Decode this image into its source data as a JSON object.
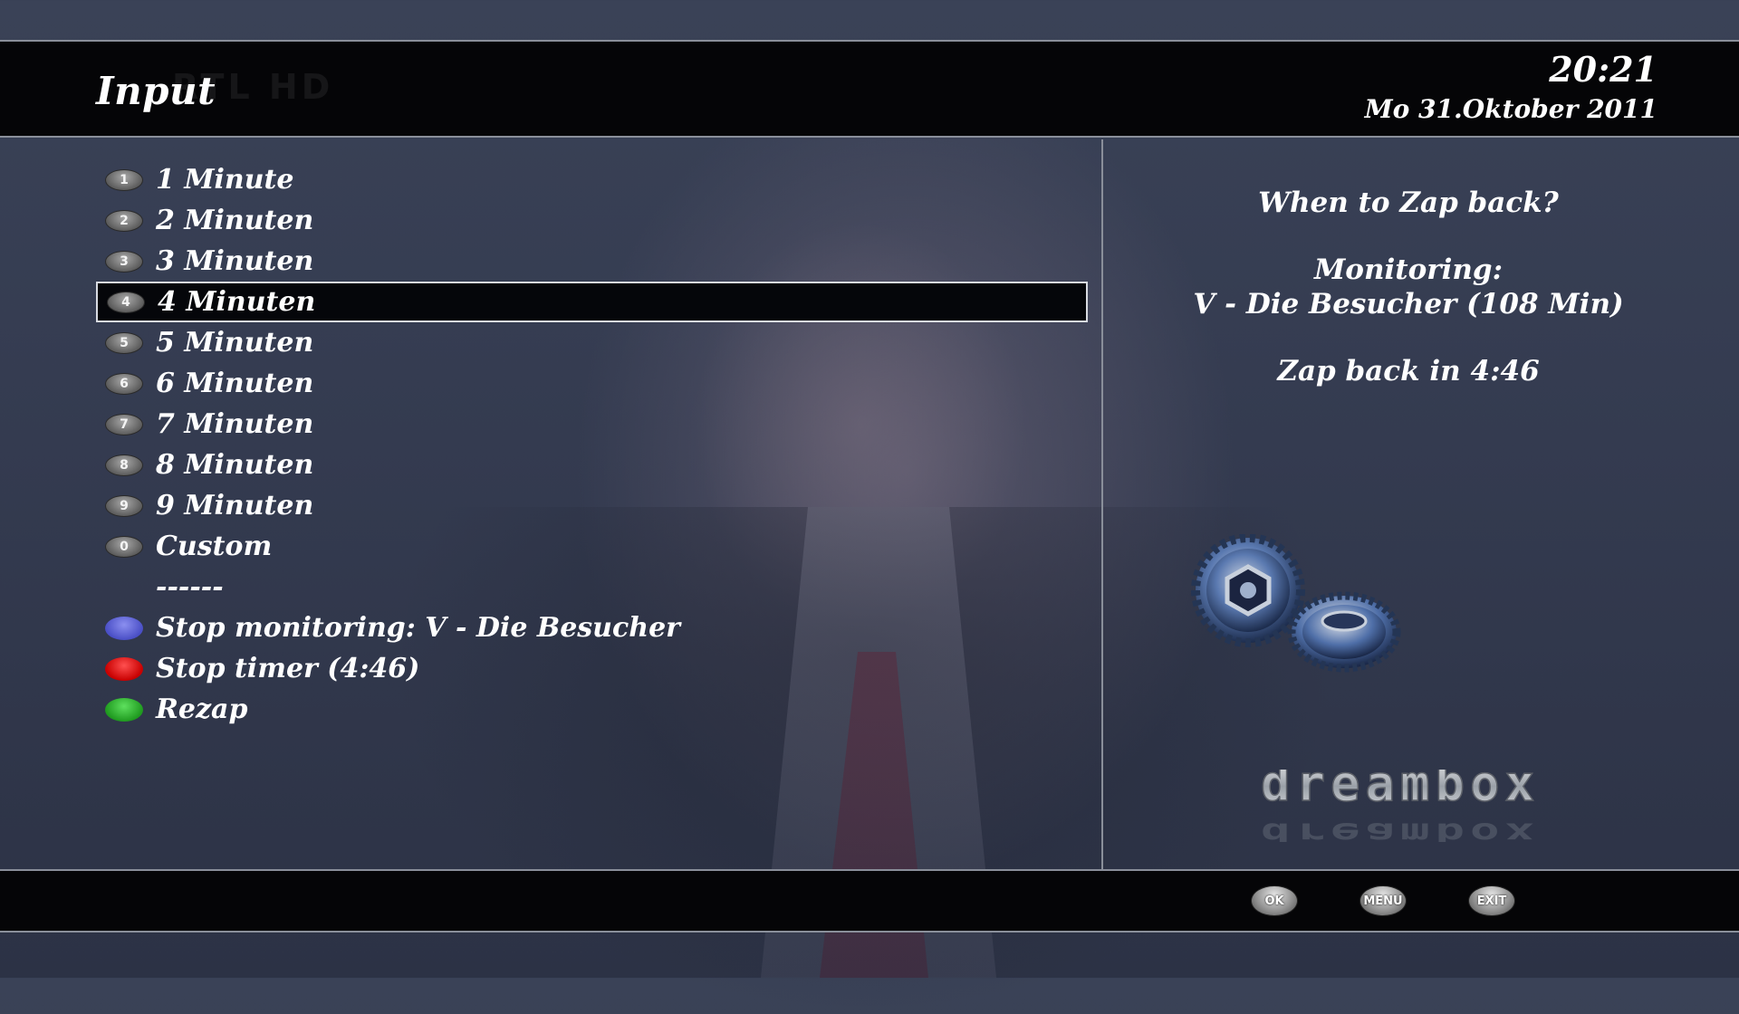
{
  "header": {
    "title": "Input",
    "channel_watermark": "RTL HD",
    "time": "20:21",
    "date": "Mo 31.Oktober 2011"
  },
  "menu": {
    "selected_index": 3,
    "items": [
      {
        "key": "1",
        "label": "1 Minute"
      },
      {
        "key": "2",
        "label": "2 Minuten"
      },
      {
        "key": "3",
        "label": "3 Minuten"
      },
      {
        "key": "4",
        "label": "4 Minuten"
      },
      {
        "key": "5",
        "label": "5 Minuten"
      },
      {
        "key": "6",
        "label": "6 Minuten"
      },
      {
        "key": "7",
        "label": "7 Minuten"
      },
      {
        "key": "8",
        "label": "8 Minuten"
      },
      {
        "key": "9",
        "label": "9 Minuten"
      },
      {
        "key": "0",
        "label": "Custom"
      }
    ],
    "separator": "------",
    "actions": [
      {
        "color": "blue",
        "label": "Stop monitoring: V - Die Besucher"
      },
      {
        "color": "red",
        "label": "Stop timer (4:46)"
      },
      {
        "color": "green",
        "label": "Rezap"
      }
    ]
  },
  "info": {
    "question": "When to Zap back?",
    "monitoring_label": "Monitoring:",
    "monitoring_program": "V - Die Besucher (108 Min)",
    "zap_back": "Zap back in 4:46"
  },
  "branding": {
    "logo_text": "dreambox"
  },
  "footer": {
    "keys": [
      "OK",
      "MENU",
      "EXIT"
    ]
  },
  "colors": {
    "key_blue": "#4a4fc6",
    "key_red": "#c80000",
    "key_green": "#1f9a1f",
    "bar_bg": "#050507"
  }
}
